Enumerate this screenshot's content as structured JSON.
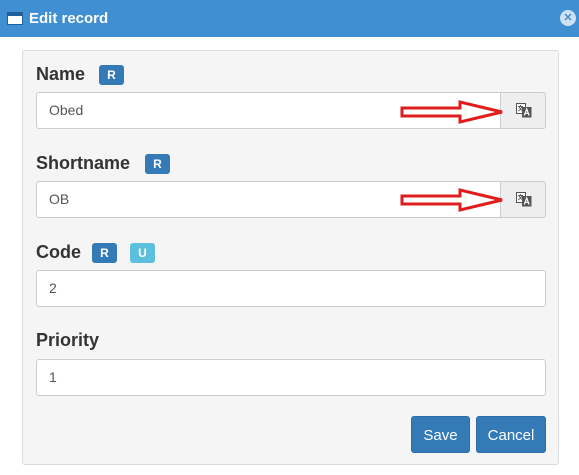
{
  "dialog": {
    "title": "Edit record",
    "close_symbol": "✕"
  },
  "fields": {
    "name": {
      "label": "Name",
      "badges": [
        "R"
      ],
      "value": "Obed"
    },
    "shortname": {
      "label": "Shortname",
      "badges": [
        "R"
      ],
      "value": "OB"
    },
    "code": {
      "label": "Code",
      "badges": [
        "R",
        "U"
      ],
      "value": "2"
    },
    "priority": {
      "label": "Priority",
      "value": "1"
    }
  },
  "buttons": {
    "save": "Save",
    "cancel": "Cancel"
  },
  "colors": {
    "titlebar": "#3f8fd2",
    "badge_r": "#337ab7",
    "badge_u": "#5bc0de",
    "primary": "#337ab7",
    "annotation_arrow": "#e01e1e"
  },
  "icons": {
    "window": "window-icon",
    "close": "close-icon",
    "translate": "translate-icon"
  }
}
